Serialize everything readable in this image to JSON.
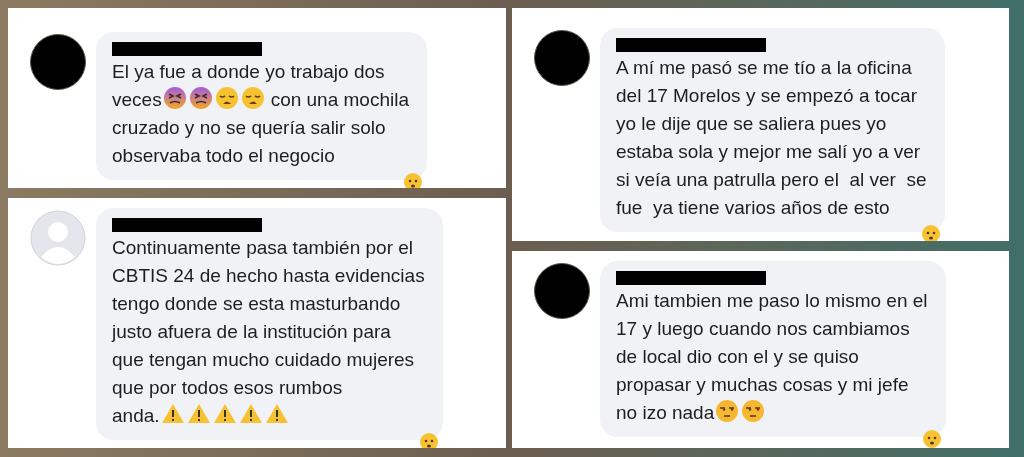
{
  "columns": [
    {
      "panels": [
        {
          "avatar": {
            "kind": "blacked-out"
          },
          "author": {
            "redacted": true
          },
          "reacted": true,
          "lines": [
            [
              {
                "kind": "text",
                "text": "El ya fue a donde yo trabajo dos"
              }
            ],
            [
              {
                "kind": "text",
                "text": "veces"
              },
              {
                "kind": "confounded-emoji"
              },
              {
                "kind": "confounded-emoji"
              },
              {
                "kind": "weary-emoji"
              },
              {
                "kind": "weary-emoji"
              },
              {
                "kind": "text",
                "text": "con una mochila"
              }
            ],
            [
              {
                "kind": "text",
                "text": "cruzado y no se quería salir solo"
              }
            ],
            [
              {
                "kind": "text",
                "text": "observaba todo el negocio"
              }
            ]
          ]
        },
        {
          "avatar": {
            "kind": "default"
          },
          "author": {
            "redacted": true
          },
          "reacted": true,
          "lines": [
            [
              {
                "kind": "text",
                "text": "Continuamente pasa también por el"
              }
            ],
            [
              {
                "kind": "text",
                "text": "CBTIS 24 de hecho hasta evidencias"
              }
            ],
            [
              {
                "kind": "text",
                "text": "tengo donde se esta masturbando"
              }
            ],
            [
              {
                "kind": "text",
                "text": "justo afuera de la institución para"
              }
            ],
            [
              {
                "kind": "text",
                "text": "que tengan mucho cuidado mujeres"
              }
            ],
            [
              {
                "kind": "text",
                "text": "que por todos esos rumbos"
              }
            ],
            [
              {
                "kind": "text",
                "text": "anda."
              },
              {
                "kind": "warning-emoji"
              },
              {
                "kind": "warning-emoji"
              },
              {
                "kind": "warning-emoji"
              },
              {
                "kind": "warning-emoji"
              },
              {
                "kind": "warning-emoji"
              }
            ]
          ]
        }
      ]
    },
    {
      "panels": [
        {
          "avatar": {
            "kind": "blacked-out"
          },
          "author": {
            "redacted": true
          },
          "reacted": true,
          "lines": [
            [
              {
                "kind": "text",
                "text": "A mí me pasó se me tío a la oficina"
              }
            ],
            [
              {
                "kind": "text",
                "text": "del 17 Morelos y se empezó a tocar"
              }
            ],
            [
              {
                "kind": "text",
                "text": "yo le dije que se saliera pues yo"
              }
            ],
            [
              {
                "kind": "text",
                "text": "estaba sola y mejor me salí yo a ver"
              }
            ],
            [
              {
                "kind": "text",
                "text": "si veía una patrulla pero el  al ver  se"
              }
            ],
            [
              {
                "kind": "text",
                "text": "fue  ya tiene varios años de esto"
              }
            ]
          ]
        },
        {
          "avatar": {
            "kind": "blacked-out"
          },
          "author": {
            "redacted": true
          },
          "reacted": true,
          "lines": [
            [
              {
                "kind": "text",
                "text": "Ami tambien me paso lo mismo en el"
              }
            ],
            [
              {
                "kind": "text",
                "text": "17 y luego cuando nos cambiamos"
              }
            ],
            [
              {
                "kind": "text",
                "text": "de local dio con el y se quiso"
              }
            ],
            [
              {
                "kind": "text",
                "text": "propasar y muchas cosas y mi jefe"
              }
            ],
            [
              {
                "kind": "text",
                "text": "no izo nada"
              },
              {
                "kind": "unamused-emoji"
              },
              {
                "kind": "unamused-emoji"
              }
            ]
          ]
        }
      ]
    }
  ]
}
